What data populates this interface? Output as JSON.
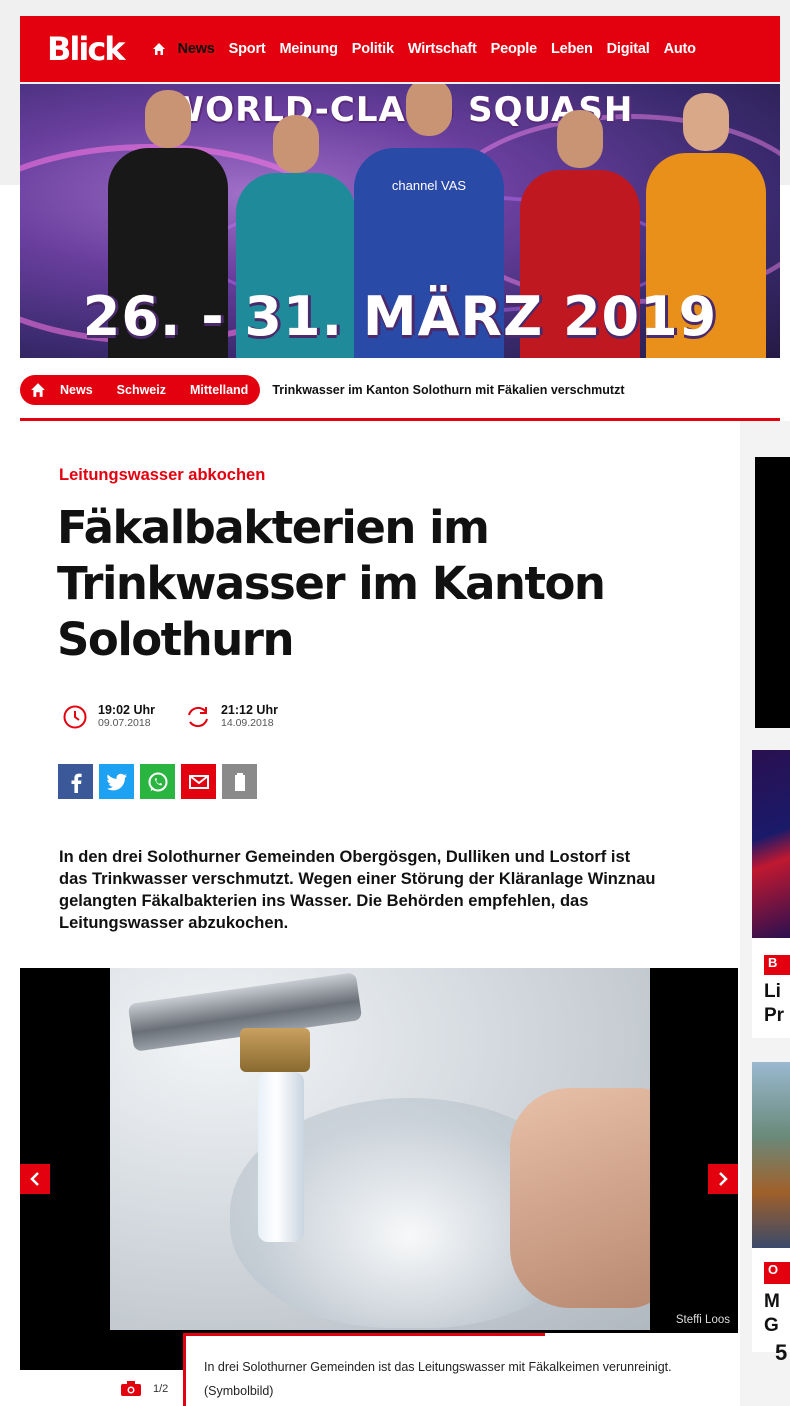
{
  "header": {
    "logo": "Blick",
    "nav": [
      "News",
      "Sport",
      "Meinung",
      "Politik",
      "Wirtschaft",
      "People",
      "Leben",
      "Digital",
      "Auto"
    ],
    "active": "News"
  },
  "banner": {
    "title": "WORLD-CLASS SQUASH",
    "sponsor_text": "channel VAS",
    "date_text": "26. - 31. MÄRZ 2019"
  },
  "breadcrumb": {
    "items": [
      "News",
      "Schweiz",
      "Mittelland"
    ],
    "current": "Trinkwasser im Kanton Solothurn mit Fäkalien verschmutzt"
  },
  "article": {
    "kicker": "Leitungswasser abkochen",
    "headline": "Fäkalbakterien im Trinkwasser im Kanton Solothurn",
    "published": {
      "time": "19:02 Uhr",
      "date": "09.07.2018"
    },
    "updated": {
      "time": "21:12 Uhr",
      "date": "14.09.2018"
    },
    "lead": "In den drei Solothurner Gemeinden Obergösgen, Dulliken und Lostorf ist das Trinkwasser verschmutzt. Wegen einer Störung der Kläranlage Winznau gelangten Fäkalbakterien ins Wasser. Die Behörden empfehlen, das Leitungswasser abzukochen."
  },
  "share": [
    "facebook-icon",
    "twitter-icon",
    "whatsapp-icon",
    "email-icon",
    "copy-icon"
  ],
  "gallery": {
    "credit": "Steffi Loos",
    "caption": "In drei Solothurner Gemeinden ist das Leitungswasser mit Fäkalkeimen verunreinigt. (Symbolbild)",
    "counter": "1/2"
  },
  "sidebar": {
    "card1": {
      "tag": "B",
      "title": "Li Pr"
    },
    "card2": {
      "tag": "O",
      "title": "M G"
    },
    "fragment": "5"
  },
  "colors": {
    "brand": "#e3000f",
    "facebook": "#3b5998",
    "twitter": "#1da1f2",
    "whatsapp": "#2ab540"
  }
}
